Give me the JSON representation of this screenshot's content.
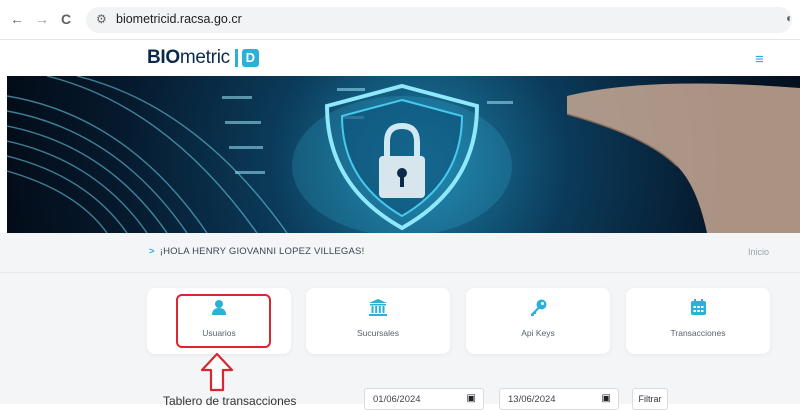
{
  "browser": {
    "url": "biometricid.racsa.go.cr",
    "back_glyph": "←",
    "forward_glyph": "→",
    "reload_glyph": "C"
  },
  "header": {
    "logo_bio": "BIO",
    "logo_metric": "metric",
    "logo_id": "D",
    "menu_glyph": "≡"
  },
  "greeting": {
    "chevron": ">",
    "text": "¡HOLA HENRY GIOVANNI LOPEZ VILLEGAS!",
    "breadcrumb": "Inicio"
  },
  "cards": [
    {
      "label": "Usuarios",
      "icon": "user-icon"
    },
    {
      "label": "Sucursales",
      "icon": "bank-icon"
    },
    {
      "label": "Api Keys",
      "icon": "key-icon"
    },
    {
      "label": "Transacciones",
      "icon": "calendar-icon"
    }
  ],
  "dashboard": {
    "title": "Tablero de transacciones",
    "date_from": "01/06/2024",
    "date_to": "13/06/2024",
    "filter_label": "Filtrar"
  },
  "colors": {
    "accent": "#2bb0d8",
    "annotation": "#d9262f",
    "navy": "#0b2a4a"
  }
}
